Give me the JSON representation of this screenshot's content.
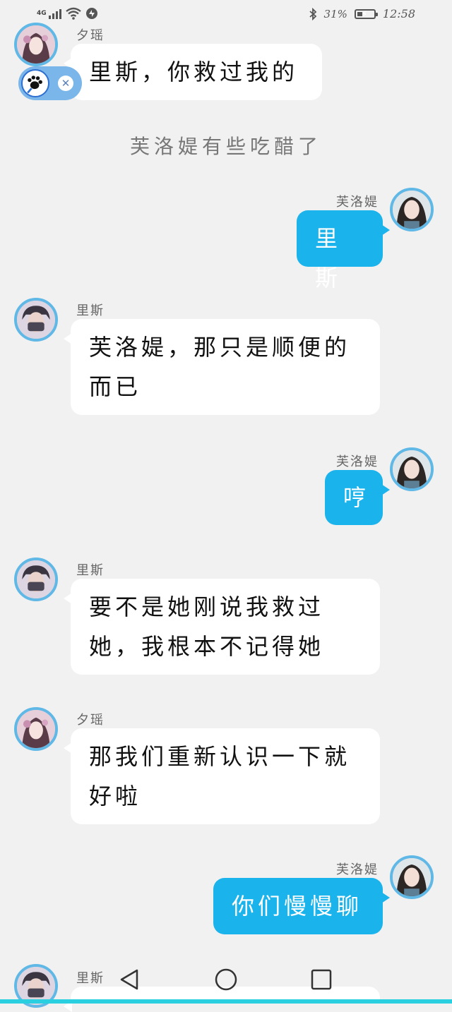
{
  "status_bar": {
    "network": "4G",
    "battery_percent": "31%",
    "battery_level": 0.31,
    "time": "12:58"
  },
  "narration": "芙洛媞有些吃醋了",
  "messages": [
    {
      "sender": "夕瑶",
      "side": "left",
      "avatar": "xiyao-avatar",
      "text": "里斯，你救过我的"
    },
    {
      "sender": "芙洛媞",
      "side": "right",
      "avatar": "fuluoti-avatar",
      "text": "里斯"
    },
    {
      "sender": "里斯",
      "side": "left",
      "avatar": "lisi-avatar",
      "text": "芙洛媞，那只是顺便的而已",
      "lines": [
        "芙洛媞，那只是顺便的",
        "而已"
      ]
    },
    {
      "sender": "芙洛媞",
      "side": "right",
      "avatar": "fuluoti-avatar",
      "text": "哼"
    },
    {
      "sender": "里斯",
      "side": "left",
      "avatar": "lisi-avatar",
      "text": "要不是她刚说我救过她，我根本不记得她",
      "lines": [
        "要不是她刚说我救过",
        "她，我根本不记得她"
      ]
    },
    {
      "sender": "夕瑶",
      "side": "left",
      "avatar": "xiyao-avatar",
      "text": "那我们重新认识一下就好啦",
      "lines": [
        "那我们重新认识一下就",
        "好啦"
      ]
    },
    {
      "sender": "芙洛媞",
      "side": "right",
      "avatar": "fuluoti-avatar",
      "text": "你们慢慢聊"
    },
    {
      "sender": "里斯",
      "side": "left",
      "avatar": "lisi-avatar",
      "text": ""
    }
  ],
  "floating_widget": {
    "icon": "paw-icon",
    "close_icon": "close-icon",
    "close_symbol": "✕"
  },
  "nav_bar": {
    "back_icon": "back-triangle-icon",
    "home_icon": "home-circle-icon",
    "recent_icon": "recent-square-icon"
  },
  "colors": {
    "accent": "#1ab3ec",
    "background": "#f1f1f1",
    "avatar_border": "#5fb8e6"
  }
}
